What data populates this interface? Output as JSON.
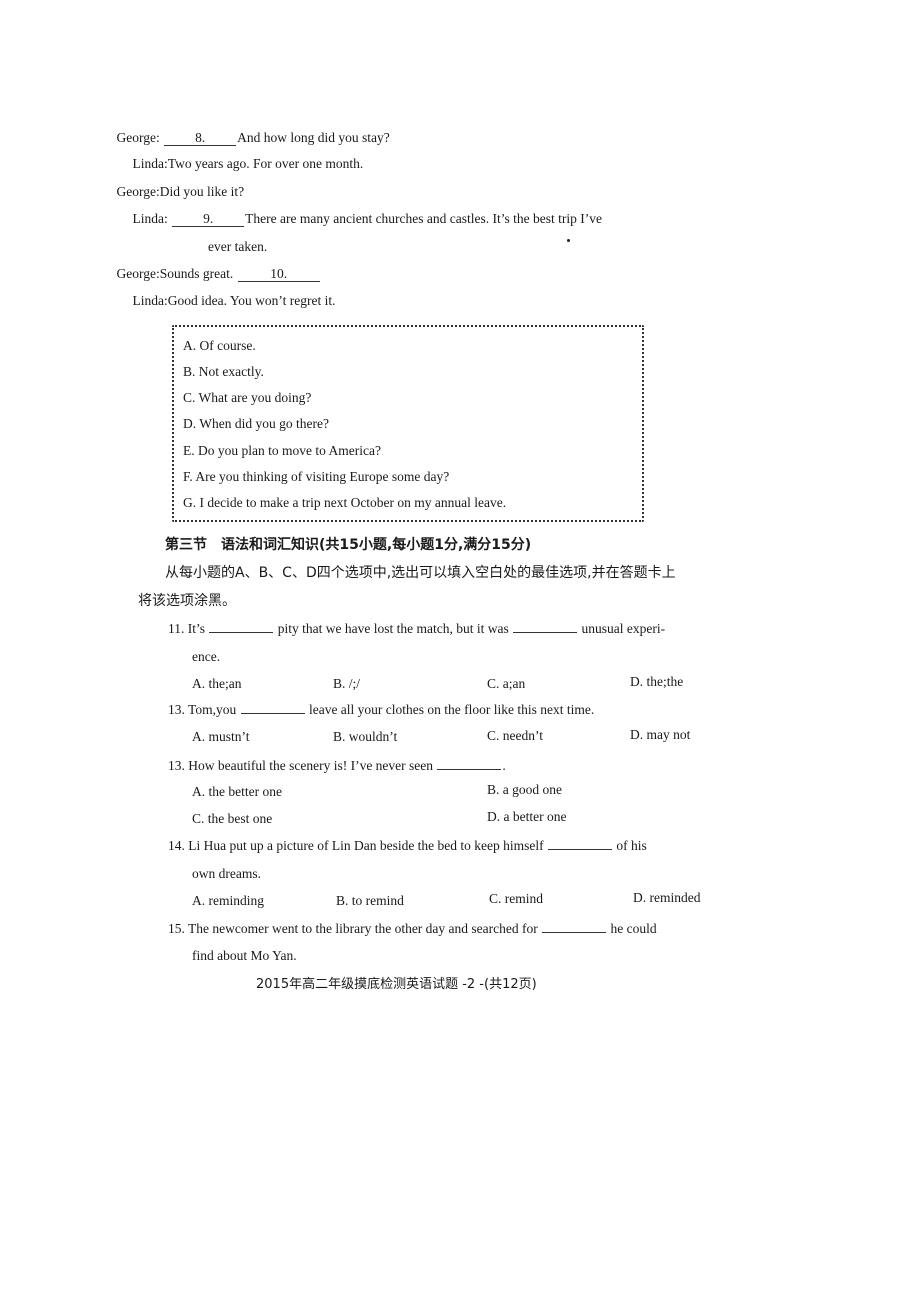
{
  "dialogue": [
    {
      "speaker": "George",
      "pre": "",
      "blank": "8.",
      "text": "And how long did you stay?"
    },
    {
      "speaker": "Linda",
      "pre": "",
      "blank": "",
      "text": "Two years ago. For over one month."
    },
    {
      "speaker": "George",
      "pre": "",
      "blank": "",
      "text": "Did you like it?"
    },
    {
      "speaker": "Linda",
      "pre": "",
      "blank": "9.",
      "text": "There are many ancient churches and castles. It’s the best trip I’ve",
      "cont": "ever taken."
    },
    {
      "speaker": "George",
      "pre": "Sounds great.",
      "blank": "10.",
      "text": ""
    },
    {
      "speaker": "Linda",
      "pre": "",
      "blank": "",
      "text": "Good idea. You won’t regret it."
    }
  ],
  "speaker_sep": ":",
  "option_box": {
    "options": [
      "A. Of course.",
      "B. Not exactly.",
      "C. What are you doing?",
      "D. When did you go there?",
      "E. Do you plan to move to America?",
      "F. Are you thinking of visiting Europe some day?",
      "G. I decide to make a trip next October on my annual leave."
    ]
  },
  "section": {
    "title": "第三节　语法和词汇知识(共15小题,每小题1分,满分15分)",
    "instruction_line1": "从每小题的A、B、C、D四个选项中,选出可以填入空白处的最佳选项,并在答题卡上",
    "instruction_line2": "将该选项涂黑。"
  },
  "questions": [
    {
      "number": "11.",
      "line1_a": "It’s",
      "line1_b": "pity that we have lost the match, but it was",
      "line1_c": "unusual experi-",
      "line2": "ence.",
      "choices": [
        "A. the;an",
        "B. /;/",
        "C. a;an",
        "D. the;the"
      ]
    },
    {
      "number": "13.",
      "line1_a": "Tom,you",
      "line1_b": "leave all your clothes on the floor like this next time.",
      "choices": [
        "A. mustn’t",
        "B. wouldn’t",
        "C. needn’t",
        "D. may not"
      ]
    },
    {
      "number": "13.",
      "line1_a": "How beautiful the scenery is! I’ve never seen",
      "line1_b": ".",
      "choices": [
        "A. the better one",
        "B. a good one",
        "C. the best one",
        "D. a better one"
      ]
    },
    {
      "number": "14.",
      "line1_a": "Li Hua put up a picture of Lin Dan beside the bed to keep himself",
      "line1_b": "of his",
      "line2": "own dreams.",
      "choices": [
        "A. reminding",
        "B. to remind",
        "C. remind",
        "D. reminded"
      ]
    },
    {
      "number": "15.",
      "line1_a": "The newcomer went to the library the other day and searched for",
      "line1_b": "he could",
      "line2": "find about Mo Yan."
    }
  ],
  "footer": "2015年高二年级摸底检测英语试题 -2 -(共12页)"
}
